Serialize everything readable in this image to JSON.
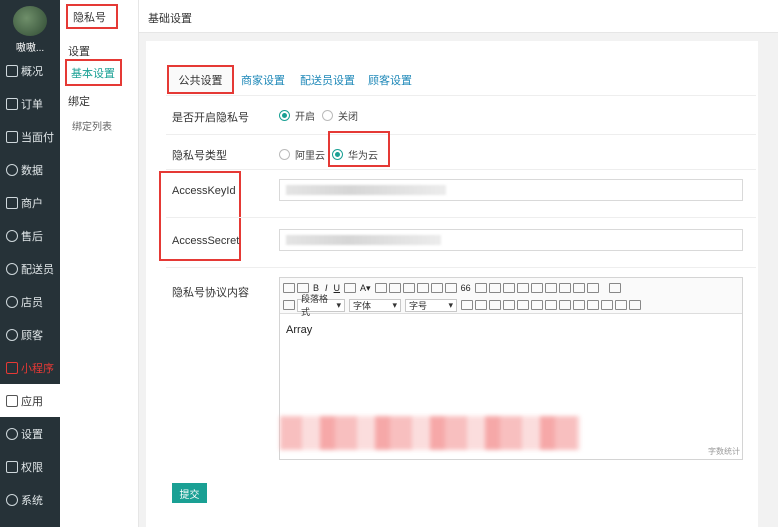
{
  "user": {
    "name": "嗷嗷..."
  },
  "sidebar": {
    "items": [
      {
        "label": "概况",
        "icon": "dashboard-icon"
      },
      {
        "label": "订单",
        "icon": "order-icon"
      },
      {
        "label": "当面付",
        "icon": "pay-icon"
      },
      {
        "label": "数据",
        "icon": "data-icon"
      },
      {
        "label": "商户",
        "icon": "shop-icon"
      },
      {
        "label": "售后",
        "icon": "aftersale-icon"
      },
      {
        "label": "配送员",
        "icon": "courier-icon"
      },
      {
        "label": "店员",
        "icon": "clerk-icon"
      },
      {
        "label": "顾客",
        "icon": "customer-icon"
      },
      {
        "label": "小程序",
        "icon": "miniprogram-icon"
      },
      {
        "label": "应用",
        "icon": "apps-icon"
      },
      {
        "label": "设置",
        "icon": "settings-icon"
      },
      {
        "label": "权限",
        "icon": "lock-icon"
      },
      {
        "label": "系统",
        "icon": "system-icon"
      }
    ]
  },
  "submenu": {
    "title": "隐私号",
    "group1": "设置",
    "item1": "基本设置",
    "group2": "绑定",
    "item2": "绑定列表"
  },
  "breadcrumb": "基础设置",
  "tabs": [
    "公共设置",
    "商家设置",
    "配送员设置",
    "顾客设置"
  ],
  "form": {
    "enable_label": "是否开启隐私号",
    "enable_on": "开启",
    "enable_off": "关闭",
    "type_label": "隐私号类型",
    "type_aliyun": "阿里云",
    "type_huawei": "华为云",
    "key_id_label": "AccessKeyId",
    "secret_label": "AccessSecret",
    "agreement_label": "隐私号协议内容",
    "editor_content": "Array",
    "editor_counter": "字数统计",
    "tb_paragraph": "段落格式",
    "tb_font": "字体",
    "tb_size": "字号",
    "submit": "提交"
  },
  "colors": {
    "accent": "#1aa094",
    "sidebar_bg": "#263238",
    "highlight_red": "#e53935",
    "tab_link": "#1e88b8"
  }
}
